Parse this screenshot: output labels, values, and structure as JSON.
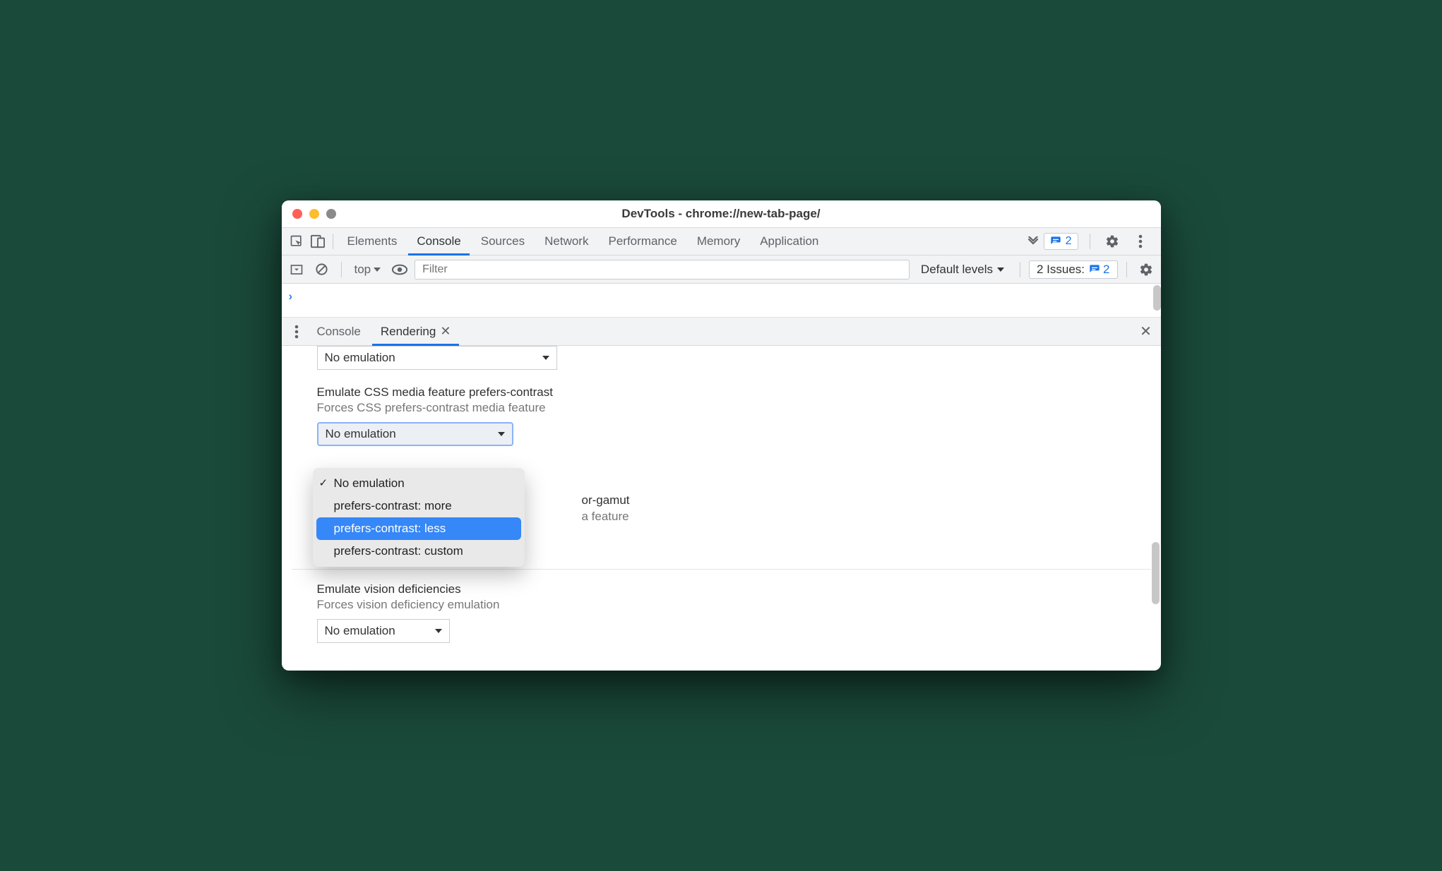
{
  "window": {
    "title": "DevTools - chrome://new-tab-page/"
  },
  "main_tabs": {
    "items": [
      "Elements",
      "Console",
      "Sources",
      "Network",
      "Performance",
      "Memory",
      "Application"
    ],
    "active_index": 1,
    "issues_count": "2"
  },
  "console_toolbar": {
    "context": "top",
    "filter_placeholder": "Filter",
    "levels": "Default levels",
    "issues_label": "2 Issues:",
    "issues_count": "2"
  },
  "drawer_tabs": {
    "items": [
      "Console",
      "Rendering"
    ],
    "active_index": 1
  },
  "rendering": {
    "top_select_value": "No emulation",
    "contrast": {
      "title": "Emulate CSS media feature prefers-contrast",
      "subtitle": "Forces CSS prefers-contrast media feature",
      "select_value": "No emulation",
      "options": [
        "No emulation",
        "prefers-contrast: more",
        "prefers-contrast: less",
        "prefers-contrast: custom"
      ],
      "checked_index": 0,
      "highlight_index": 2
    },
    "color_gamut": {
      "title_fragment": "or-gamut",
      "subtitle_fragment": "a feature"
    },
    "vision": {
      "title": "Emulate vision deficiencies",
      "subtitle": "Forces vision deficiency emulation",
      "select_value": "No emulation"
    }
  }
}
